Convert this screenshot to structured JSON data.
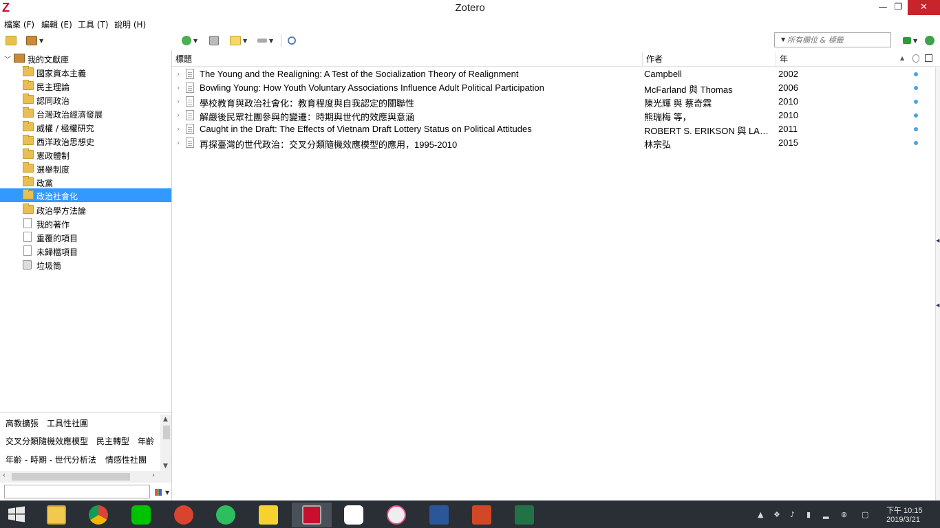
{
  "window": {
    "title": "Zotero",
    "logo": "Z",
    "min": "—",
    "max": "❐",
    "close": "✕"
  },
  "menu": [
    {
      "label": "檔案 (F)"
    },
    {
      "label": "編輯 (E)"
    },
    {
      "label": "工具 (T)"
    },
    {
      "label": "說明 (H)"
    }
  ],
  "toolbar": {
    "search_placeholder": "所有欄位 & 標籤",
    "icons": [
      "new-collection-icon",
      "new-library-icon",
      "new-item-icon",
      "add-by-identifier-icon",
      "new-note-icon",
      "add-attachment-icon",
      "advanced-search-icon",
      "locate-icon",
      "sync-icon"
    ]
  },
  "collections": {
    "library": "我的文獻庫",
    "items": [
      {
        "label": "國家資本主義"
      },
      {
        "label": "民主理論"
      },
      {
        "label": "認同政治"
      },
      {
        "label": "台灣政治經濟發展"
      },
      {
        "label": "威權 / 極權研究"
      },
      {
        "label": "西洋政治思想史"
      },
      {
        "label": "憲政體制"
      },
      {
        "label": "選舉制度"
      },
      {
        "label": "政黨"
      },
      {
        "label": "政治社會化"
      },
      {
        "label": "政治學方法論"
      },
      {
        "label": "我的著作"
      },
      {
        "label": "重覆的項目"
      },
      {
        "label": "未歸檔項目"
      },
      {
        "label": "垃圾筒"
      }
    ],
    "selected": "政治社會化"
  },
  "tags": {
    "rows": [
      [
        "高教擴張",
        "工具性社團"
      ],
      [
        "交叉分類隨機效應模型",
        "民主轉型",
        "年齡"
      ],
      [
        "年齡 - 時期 - 世代分析法",
        "情感性社團"
      ]
    ]
  },
  "columns": {
    "title": "標題",
    "creator": "作者",
    "year": "年"
  },
  "items": [
    {
      "title": "The Young and the Realigning: A Test of the Socialization Theory of Realignment",
      "creator": "Campbell",
      "year": "2002"
    },
    {
      "title": "Bowling Young: How Youth Voluntary Associations Influence Adult Political Participation",
      "creator": "McFarland 與 Thomas",
      "year": "2006"
    },
    {
      "title": "學校教育與政治社會化：教育程度與自我認定的關聯性",
      "creator": "陳光輝 與 蔡奇霖",
      "year": "2010"
    },
    {
      "title": "解嚴後民眾社團參與的變遷：時期與世代的效應與意涵",
      "creator": "熊瑞梅 等，",
      "year": "2010"
    },
    {
      "title": "Caught in the Draft: The Effects of Vietnam Draft Lottery Status on Political Attitudes",
      "creator": "ROBERT S. ERIKSON 與 LAURA S...",
      "year": "2011"
    },
    {
      "title": "再探臺灣的世代政治：交叉分類隨機效應模型的應用，1995-2010",
      "creator": "林宗弘",
      "year": "2015"
    }
  ],
  "taskbar": {
    "apps": [
      "file-explorer-icon",
      "chrome-icon",
      "line-icon",
      "ccleaner-icon",
      "evernote-icon",
      "stickies-icon",
      "zotero-icon",
      "icloud-icon",
      "itunes-icon",
      "word-icon",
      "powerpoint-icon",
      "excel-icon"
    ],
    "time": "下午 10:15",
    "date": "2019/3/21"
  }
}
